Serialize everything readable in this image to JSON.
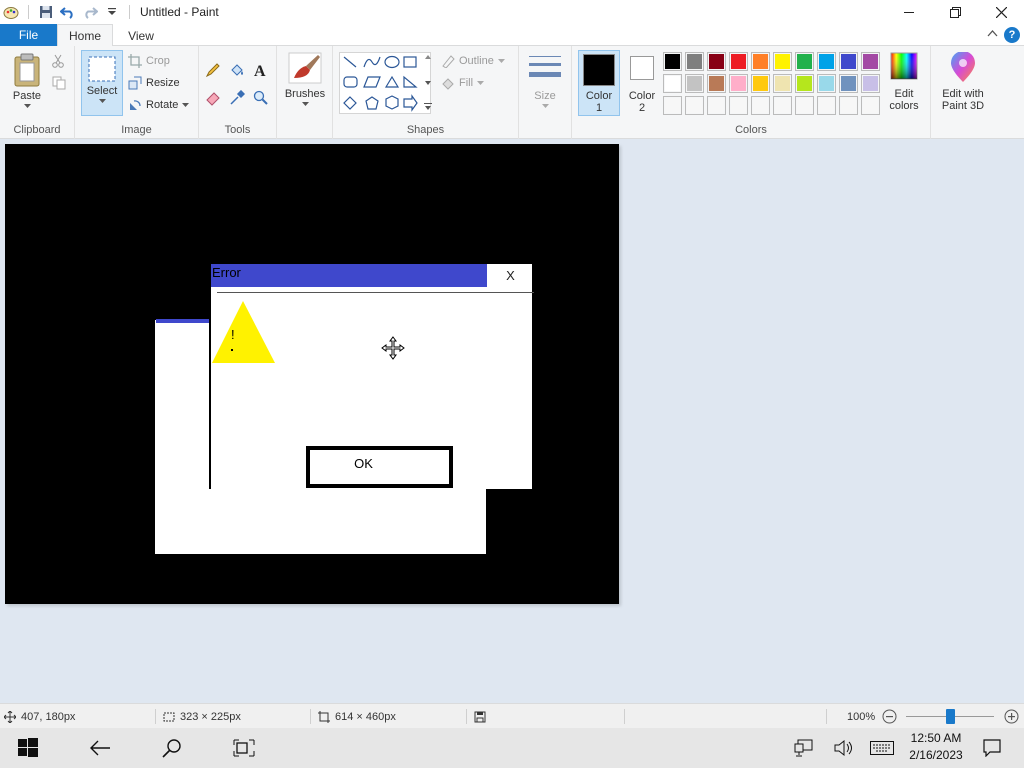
{
  "window": {
    "title": "Untitled - Paint"
  },
  "tabs": {
    "file": "File",
    "home": "Home",
    "view": "View"
  },
  "ribbon": {
    "clipboard": {
      "paste": "Paste",
      "group": "Clipboard"
    },
    "image": {
      "select": "Select",
      "crop": "Crop",
      "resize": "Resize",
      "rotate": "Rotate",
      "group": "Image"
    },
    "tools": {
      "group": "Tools"
    },
    "brushes": {
      "label": "Brushes"
    },
    "shapes": {
      "outline": "Outline",
      "fill": "Fill",
      "group": "Shapes"
    },
    "size": {
      "label": "Size"
    },
    "colors": {
      "color1_label": "Color",
      "color1_num": "1",
      "color2_label": "Color",
      "color2_num": "2",
      "edit_colors_1": "Edit",
      "edit_colors_2": "colors",
      "group": "Colors",
      "color1": "#000000",
      "color2": "#ffffff",
      "palette_row1": [
        "#000000",
        "#7f7f7f",
        "#880015",
        "#ed1c24",
        "#ff7f27",
        "#fff200",
        "#22b14c",
        "#00a2e8",
        "#3f48cc",
        "#a349a4"
      ],
      "palette_row2": [
        "#ffffff",
        "#c3c3c3",
        "#b97a57",
        "#ffaec9",
        "#ffc90e",
        "#efe4b0",
        "#b5e61d",
        "#99d9ea",
        "#7092be",
        "#c8bfe7"
      ],
      "palette_row3": [
        "#ffffff",
        "#ffffff",
        "#ffffff",
        "#ffffff",
        "#ffffff",
        "#ffffff",
        "#ffffff",
        "#ffffff",
        "#ffffff",
        "#ffffff"
      ]
    },
    "paint3d": {
      "line1": "Edit with",
      "line2": "Paint 3D"
    }
  },
  "canvas": {
    "dialog": {
      "title": "Error",
      "close": "X",
      "ok": "OK",
      "icon_text": "!",
      "titlebar_color": "#3f48cc"
    }
  },
  "statusbar": {
    "cursor_pos": "407, 180px",
    "selection_size": "323 × 225px",
    "image_size": "614 × 460px",
    "zoom": "100%"
  },
  "taskbar": {
    "time": "12:50 AM",
    "date": "2/16/2023"
  }
}
